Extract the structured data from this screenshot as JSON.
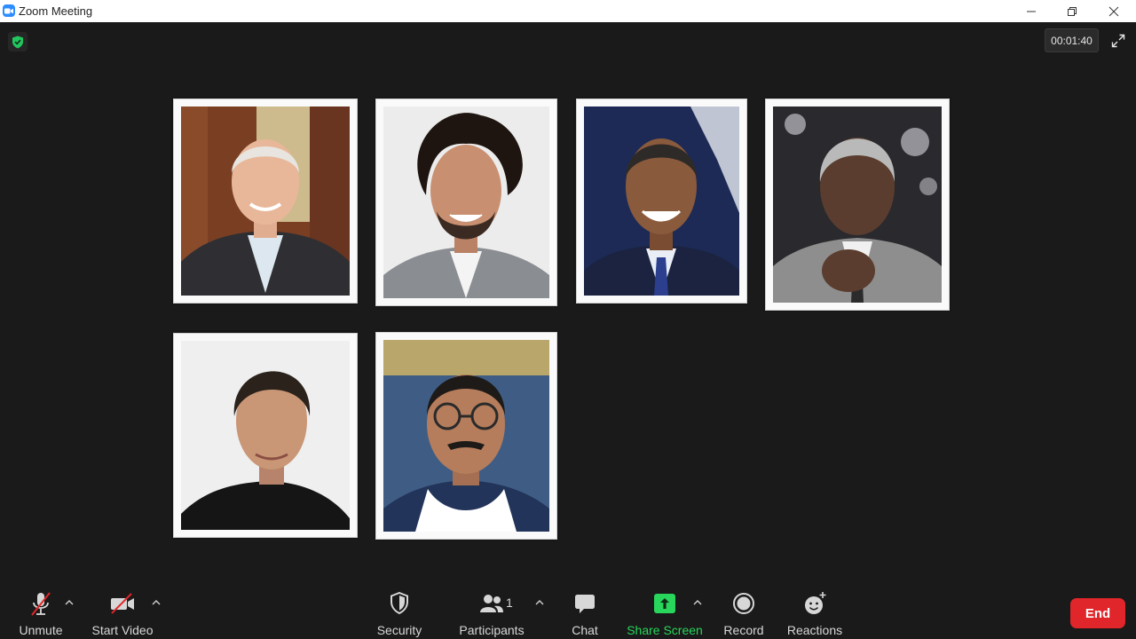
{
  "window": {
    "title": "Zoom Meeting",
    "icon": "zoom-camera-icon",
    "controls": [
      "minimize-icon",
      "restore-icon",
      "close-icon"
    ]
  },
  "meeting": {
    "timer": "00:01:40",
    "encryption_icon": "shield-check-icon",
    "fullscreen_icon": "expand-icon",
    "accent_green": "#27d65a",
    "participants": [
      {
        "name": "",
        "id": "participant-1",
        "bg": "#7a3f22",
        "skin": "#e8b79a",
        "hair": "#e8e4df",
        "suit": "#2f2f33",
        "shirt": "#dce7f0"
      },
      {
        "name": "",
        "id": "participant-2",
        "bg": "#ececec",
        "skin": "#c89071",
        "hair": "#1e1510",
        "suit": "#8a8d91",
        "shirt": "#f4f4f4"
      },
      {
        "name": "",
        "id": "participant-3",
        "bg": "#1c2a55",
        "skin": "#8a5a3c",
        "hair": "#2e2a28",
        "suit": "#1c2340",
        "shirt": "#e9eef6"
      },
      {
        "name": "",
        "id": "participant-4",
        "bg": "#2a2a2e",
        "skin": "#5a3d2e",
        "hair": "#b9b9b9",
        "suit": "#8e8e8e",
        "shirt": "#f0f0f0"
      },
      {
        "name": "",
        "id": "participant-5",
        "bg": "#efefef",
        "skin": "#c99676",
        "hair": "#2b221c",
        "suit": "#151515",
        "shirt": "#151515"
      },
      {
        "name": "",
        "id": "participant-6",
        "bg": "#3f5d84",
        "skin": "#b57d5c",
        "hair": "#1d1a18",
        "suit": "#ffffff",
        "shirt": "#23345a"
      }
    ]
  },
  "toolbar": {
    "unmute": "Unmute",
    "start_video": "Start Video",
    "security": "Security",
    "participants": "Participants",
    "participants_count": "1",
    "chat": "Chat",
    "share_screen": "Share Screen",
    "record": "Record",
    "reactions": "Reactions",
    "end": "End",
    "end_color": "#e0262b"
  }
}
